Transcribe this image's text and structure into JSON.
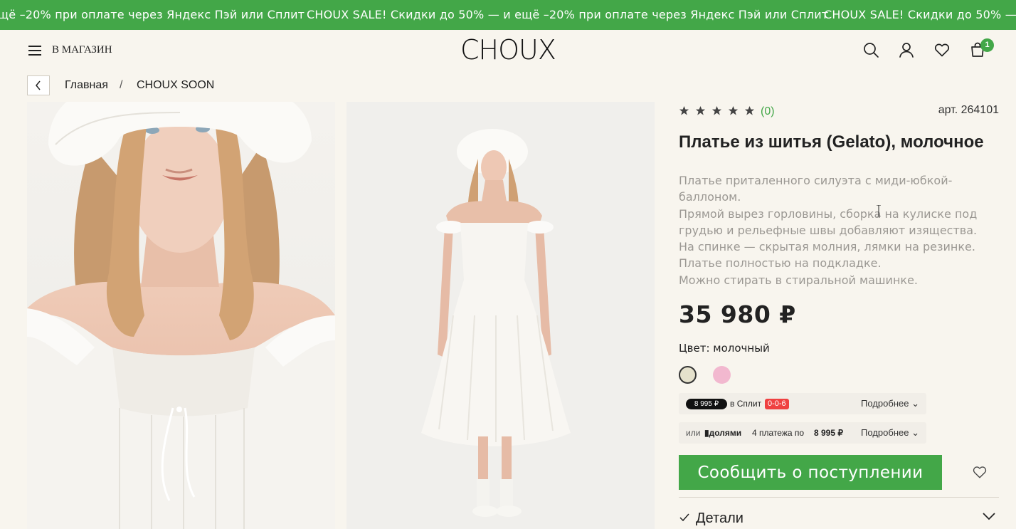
{
  "promo": {
    "pieces": [
      "щё –20% при оплате через Яндекс Пэй или Сплит",
      "CHOUX SALE! Скидки до 50% — и ещё –20% при оплате через Яндекс Пэй или Сплит",
      "CHOUX SALE! Скидки до 50% —"
    ]
  },
  "header": {
    "shop_label": "В МАГАЗИН",
    "logo": "CHOUX",
    "cart_count": "1"
  },
  "breadcrumb": {
    "home": "Главная",
    "separator": "/",
    "current": "CHOUX SOON"
  },
  "product": {
    "rating_count": "(0)",
    "sku": "арт. 264101",
    "title": "Платье из шитья (Gelato), молочное",
    "description_lines": [
      "Платье приталенного силуэта с миди-юбкой-",
      "баллоном.",
      "Прямой вырез горловины, сборка на кулиске под",
      "грудью и рельефные швы добавляют изящества.",
      "На спинке — скрытая молния, лямки на резинке.",
      "Платье полностью на подкладке.",
      "Можно стирать в стиральной машинке."
    ],
    "price": "35 980 ₽",
    "color_label": "Цвет: молочный",
    "swatches": [
      "#e5e1cc",
      "#f2b8cf"
    ],
    "selected_swatch": 0,
    "split": {
      "amount": "8 995 ₽",
      "label": "в Сплит",
      "badge": "0-0-6",
      "more": "Подробнее"
    },
    "dolyami": {
      "prefix": "или",
      "brand": "долями",
      "text": "4 платежа по",
      "amount": "8 995 ₽",
      "more": "Подробнее"
    },
    "cta": "Сообщить о поступлении",
    "details": "Детали"
  },
  "colors": {
    "accent": "#43a748",
    "background": "#f8f5ee",
    "split_badge": "#ef4141"
  }
}
